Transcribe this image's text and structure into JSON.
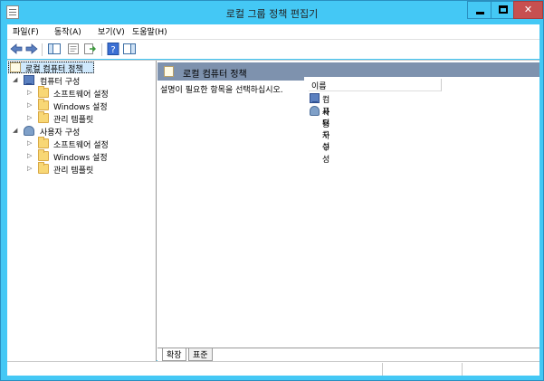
{
  "window": {
    "title": "로컬 그룹 정책 편집기"
  },
  "menu": {
    "file": "파일(F)",
    "action": "동작(A)",
    "view": "보기(V)",
    "help": "도움말(H)"
  },
  "toolbar": {
    "icons": [
      "back-icon",
      "forward-icon",
      "show-hide-tree-icon",
      "properties-icon",
      "export-list-icon",
      "help-icon",
      "show-hide-action-pane-icon"
    ]
  },
  "tree": {
    "root": "로컬 컴퓨터 정책",
    "computer": "컴퓨터 구성",
    "computer_children": [
      "소프트웨어 설정",
      "Windows 설정",
      "관리 템플릿"
    ],
    "user": "사용자 구성",
    "user_children": [
      "소프트웨어 설정",
      "Windows 설정",
      "관리 템플릿"
    ]
  },
  "right": {
    "header": "로컬 컴퓨터 정책",
    "description": "설명이 필요한 항목을 선택하십시오.",
    "column_name": "이름",
    "items": [
      "컴퓨터 구성",
      "사용자 구성"
    ]
  },
  "tabs": {
    "extended": "확장",
    "standard": "표준"
  },
  "colors": {
    "titlebar": "#44c8f5",
    "close": "#c75050",
    "header": "#7e92ae",
    "folder": "#f8d775"
  }
}
